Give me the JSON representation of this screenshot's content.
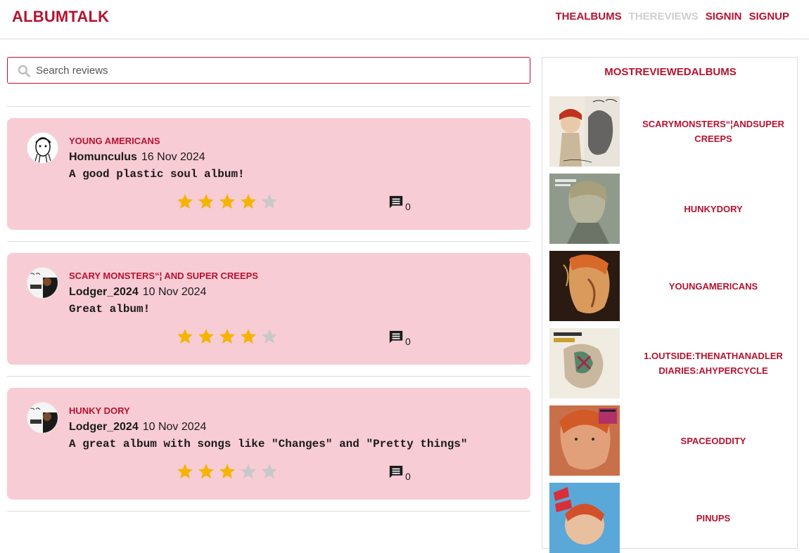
{
  "brand": {
    "name": "ALBUMTALK",
    "accent_color": "#b5122f"
  },
  "nav": {
    "items": [
      {
        "label": "THEALBUMS",
        "active": true
      },
      {
        "label": "THEREVIEWS",
        "active": false
      },
      {
        "label": "SIGNIN",
        "active": true
      },
      {
        "label": "SIGNUP",
        "active": true
      }
    ]
  },
  "search": {
    "placeholder": "Search reviews",
    "value": "",
    "icon": "search-icon"
  },
  "reviews": [
    {
      "album": "YOUNG AMERICANS",
      "user": "Homunculus",
      "date": "16 Nov 2024",
      "text": "A good plastic soul album!",
      "rating": 4,
      "max_rating": 5,
      "comments": "0"
    },
    {
      "album": "SCARY MONSTERS“¦ AND SUPER CREEPS",
      "user": "Lodger_2024",
      "date": "10 Nov 2024",
      "text": "Great album!",
      "rating": 4,
      "max_rating": 5,
      "comments": "0"
    },
    {
      "album": "HUNKY DORY",
      "user": "Lodger_2024",
      "date": "10 Nov 2024",
      "text": "A great album with songs like \"Changes\" and \"Pretty things\"",
      "rating": 3,
      "max_rating": 5,
      "comments": "0"
    }
  ],
  "sidebar": {
    "title": "MOSTREVIEWEDALBUMS",
    "albums": [
      {
        "title": "SCARYMONSTERS“¦ANDSUPER CREEPS"
      },
      {
        "title": "HUNKYDORY"
      },
      {
        "title": "YOUNGAMERICANS"
      },
      {
        "title": "1.OUTSIDE:THENATHANADLER DIARIES:AHYPERCYCLE"
      },
      {
        "title": "SPACEODDITY"
      },
      {
        "title": "PINUPS"
      }
    ]
  },
  "colors": {
    "card_bg": "#f8ccd5",
    "star_on": "#f5b400",
    "star_off": "#c8c8c8"
  }
}
